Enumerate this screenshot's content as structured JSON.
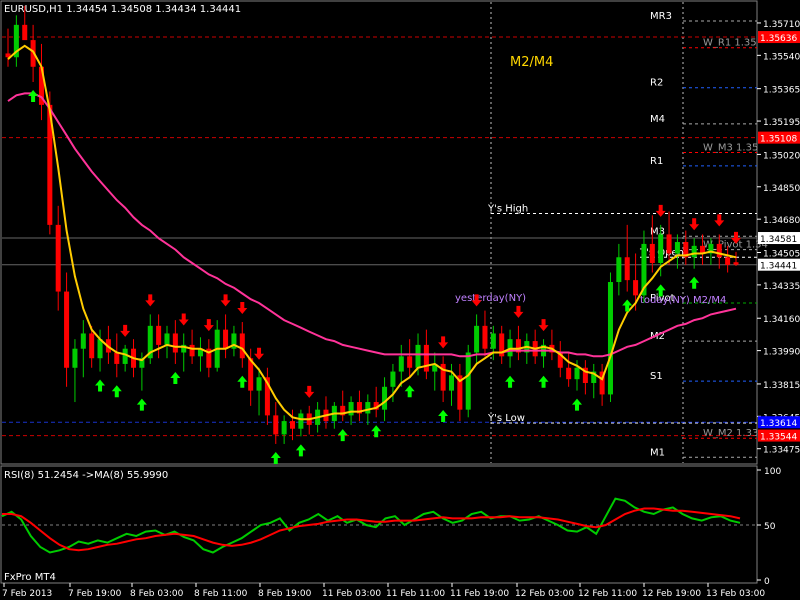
{
  "chart_data": [
    {
      "type": "candlestick",
      "title": "EURUSD,H1 1.34454 1.34508 1.34434 1.34441",
      "symbol": "EURUSD",
      "timeframe": "H1",
      "ohlc_header": "1.34454 1.34508 1.34434 1.34441",
      "indicator_label": "M2/M4",
      "ylim": [
        1.334,
        1.3582
      ],
      "price_ticks": [
        "1.35710",
        "1.35540",
        "1.35365",
        "1.35195",
        "1.35020",
        "1.34850",
        "1.34680",
        "1.34505",
        "1.34335",
        "1.34160",
        "1.33990",
        "1.33815",
        "1.33645",
        "1.33475"
      ],
      "price_tick_values": [
        1.3571,
        1.3554,
        1.35365,
        1.35195,
        1.3502,
        1.3485,
        1.3468,
        1.34505,
        1.34335,
        1.3416,
        1.3399,
        1.33815,
        1.33645,
        1.33475
      ],
      "price_badges": [
        {
          "text": "1.35636",
          "value": 1.35636,
          "color": "#ff0000"
        },
        {
          "text": "1.35108",
          "value": 1.35108,
          "color": "#ff0000"
        },
        {
          "text": "1.34581",
          "value": 1.34581,
          "color": "#ffffff"
        },
        {
          "text": "1.34441",
          "value": 1.34441,
          "color": "#ffffff"
        },
        {
          "text": "1.33614",
          "value": 1.33614,
          "color": "#0000ff"
        },
        {
          "text": "1.33544",
          "value": 1.33544,
          "color": "#ff0000"
        }
      ],
      "level_labels": [
        {
          "text": "MR3",
          "value": 1.3572
        },
        {
          "text": "W_R1 1.35",
          "value": 1.3558
        },
        {
          "text": "R2",
          "value": 1.3537
        },
        {
          "text": "M4",
          "value": 1.3518
        },
        {
          "text": "W_M3 1.35",
          "value": 1.3503
        },
        {
          "text": "R1",
          "value": 1.3496
        },
        {
          "text": "Y's High",
          "value": 1.3471
        },
        {
          "text": "M3",
          "value": 1.3459
        },
        {
          "text": "W_Pivot 1.34",
          "value": 1.3452
        },
        {
          "text": "T's Open",
          "value": 1.3448
        },
        {
          "text": "yesterday(NY)",
          "value": 1.3424
        },
        {
          "text": "Pivot",
          "value": 1.3424
        },
        {
          "text": "today(NY) M2/M4",
          "value": 1.3423
        },
        {
          "text": "M2",
          "value": 1.3404
        },
        {
          "text": "S1",
          "value": 1.3383
        },
        {
          "text": "Y's Low",
          "value": 1.3361
        },
        {
          "text": "W_M2 1.33",
          "value": 1.3353
        },
        {
          "text": "M1",
          "value": 1.3343
        }
      ],
      "colors": {
        "bull": "#00cc00",
        "bear": "#ff0000",
        "fast_ma": "#ffcc00",
        "slow_ma": "#ff3399",
        "text": "#ffffff",
        "indicator_label": "#ffd700"
      },
      "candles": [
        {
          "o": 1.3555,
          "h": 1.3568,
          "l": 1.3548,
          "c": 1.3553
        },
        {
          "o": 1.3553,
          "h": 1.3575,
          "l": 1.3548,
          "c": 1.357
        },
        {
          "o": 1.357,
          "h": 1.358,
          "l": 1.3565,
          "c": 1.3562
        },
        {
          "o": 1.3562,
          "h": 1.357,
          "l": 1.354,
          "c": 1.3548
        },
        {
          "o": 1.3548,
          "h": 1.356,
          "l": 1.352,
          "c": 1.3528
        },
        {
          "o": 1.3528,
          "h": 1.3535,
          "l": 1.346,
          "c": 1.3465
        },
        {
          "o": 1.3465,
          "h": 1.3475,
          "l": 1.342,
          "c": 1.343
        },
        {
          "o": 1.343,
          "h": 1.344,
          "l": 1.338,
          "c": 1.339
        },
        {
          "o": 1.339,
          "h": 1.3405,
          "l": 1.3372,
          "c": 1.34
        },
        {
          "o": 1.34,
          "h": 1.3415,
          "l": 1.3385,
          "c": 1.3408
        },
        {
          "o": 1.3408,
          "h": 1.3412,
          "l": 1.339,
          "c": 1.3395
        },
        {
          "o": 1.3395,
          "h": 1.341,
          "l": 1.3388,
          "c": 1.3405
        },
        {
          "o": 1.3405,
          "h": 1.3412,
          "l": 1.3392,
          "c": 1.3398
        },
        {
          "o": 1.3398,
          "h": 1.3408,
          "l": 1.3385,
          "c": 1.3392
        },
        {
          "o": 1.3392,
          "h": 1.3402,
          "l": 1.3388,
          "c": 1.34
        },
        {
          "o": 1.34,
          "h": 1.3405,
          "l": 1.3385,
          "c": 1.339
        },
        {
          "o": 1.339,
          "h": 1.3398,
          "l": 1.3378,
          "c": 1.3395
        },
        {
          "o": 1.3395,
          "h": 1.3418,
          "l": 1.3392,
          "c": 1.3412
        },
        {
          "o": 1.3412,
          "h": 1.3418,
          "l": 1.3395,
          "c": 1.3402
        },
        {
          "o": 1.3402,
          "h": 1.3412,
          "l": 1.3395,
          "c": 1.3408
        },
        {
          "o": 1.3408,
          "h": 1.3415,
          "l": 1.3392,
          "c": 1.3398
        },
        {
          "o": 1.3398,
          "h": 1.3408,
          "l": 1.3388,
          "c": 1.3402
        },
        {
          "o": 1.3402,
          "h": 1.341,
          "l": 1.3392,
          "c": 1.3396
        },
        {
          "o": 1.3396,
          "h": 1.3406,
          "l": 1.3388,
          "c": 1.34
        },
        {
          "o": 1.34,
          "h": 1.3405,
          "l": 1.3385,
          "c": 1.339
        },
        {
          "o": 1.339,
          "h": 1.3415,
          "l": 1.3388,
          "c": 1.341
        },
        {
          "o": 1.341,
          "h": 1.3418,
          "l": 1.3395,
          "c": 1.34
        },
        {
          "o": 1.34,
          "h": 1.3412,
          "l": 1.3396,
          "c": 1.3408
        },
        {
          "o": 1.3408,
          "h": 1.3414,
          "l": 1.339,
          "c": 1.3395
        },
        {
          "o": 1.3395,
          "h": 1.34,
          "l": 1.337,
          "c": 1.3378
        },
        {
          "o": 1.3378,
          "h": 1.339,
          "l": 1.3365,
          "c": 1.3385
        },
        {
          "o": 1.3385,
          "h": 1.339,
          "l": 1.336,
          "c": 1.3365
        },
        {
          "o": 1.3365,
          "h": 1.3372,
          "l": 1.335,
          "c": 1.3355
        },
        {
          "o": 1.3355,
          "h": 1.3365,
          "l": 1.335,
          "c": 1.3362
        },
        {
          "o": 1.3362,
          "h": 1.3368,
          "l": 1.3352,
          "c": 1.3358
        },
        {
          "o": 1.3358,
          "h": 1.3368,
          "l": 1.3354,
          "c": 1.3366
        },
        {
          "o": 1.3366,
          "h": 1.337,
          "l": 1.3355,
          "c": 1.336
        },
        {
          "o": 1.336,
          "h": 1.3372,
          "l": 1.3356,
          "c": 1.3368
        },
        {
          "o": 1.3368,
          "h": 1.3375,
          "l": 1.3358,
          "c": 1.3362
        },
        {
          "o": 1.3362,
          "h": 1.3372,
          "l": 1.3358,
          "c": 1.337
        },
        {
          "o": 1.337,
          "h": 1.3378,
          "l": 1.3362,
          "c": 1.3365
        },
        {
          "o": 1.3365,
          "h": 1.3375,
          "l": 1.336,
          "c": 1.3372
        },
        {
          "o": 1.3372,
          "h": 1.3378,
          "l": 1.3362,
          "c": 1.3366
        },
        {
          "o": 1.3366,
          "h": 1.3376,
          "l": 1.336,
          "c": 1.3372
        },
        {
          "o": 1.3372,
          "h": 1.338,
          "l": 1.3364,
          "c": 1.3368
        },
        {
          "o": 1.3368,
          "h": 1.3385,
          "l": 1.3362,
          "c": 1.338
        },
        {
          "o": 1.338,
          "h": 1.3392,
          "l": 1.3372,
          "c": 1.3388
        },
        {
          "o": 1.3388,
          "h": 1.3402,
          "l": 1.338,
          "c": 1.3396
        },
        {
          "o": 1.3396,
          "h": 1.3405,
          "l": 1.3385,
          "c": 1.339
        },
        {
          "o": 1.339,
          "h": 1.3408,
          "l": 1.3386,
          "c": 1.3402
        },
        {
          "o": 1.3402,
          "h": 1.341,
          "l": 1.3384,
          "c": 1.3388
        },
        {
          "o": 1.3388,
          "h": 1.3398,
          "l": 1.3378,
          "c": 1.3392
        },
        {
          "o": 1.3392,
          "h": 1.3396,
          "l": 1.3372,
          "c": 1.3378
        },
        {
          "o": 1.3378,
          "h": 1.3392,
          "l": 1.337,
          "c": 1.3386
        },
        {
          "o": 1.3386,
          "h": 1.3392,
          "l": 1.3362,
          "c": 1.3368
        },
        {
          "o": 1.3368,
          "h": 1.3402,
          "l": 1.3364,
          "c": 1.3398
        },
        {
          "o": 1.3398,
          "h": 1.3418,
          "l": 1.3392,
          "c": 1.3412
        },
        {
          "o": 1.3412,
          "h": 1.342,
          "l": 1.3396,
          "c": 1.34
        },
        {
          "o": 1.34,
          "h": 1.3412,
          "l": 1.3394,
          "c": 1.3408
        },
        {
          "o": 1.3408,
          "h": 1.3412,
          "l": 1.3392,
          "c": 1.3396
        },
        {
          "o": 1.3396,
          "h": 1.341,
          "l": 1.339,
          "c": 1.3405
        },
        {
          "o": 1.3405,
          "h": 1.3412,
          "l": 1.3394,
          "c": 1.3398
        },
        {
          "o": 1.3398,
          "h": 1.3408,
          "l": 1.3392,
          "c": 1.3404
        },
        {
          "o": 1.3404,
          "h": 1.341,
          "l": 1.3392,
          "c": 1.3396
        },
        {
          "o": 1.3396,
          "h": 1.3405,
          "l": 1.339,
          "c": 1.3402
        },
        {
          "o": 1.3402,
          "h": 1.341,
          "l": 1.3394,
          "c": 1.3398
        },
        {
          "o": 1.3398,
          "h": 1.3404,
          "l": 1.3385,
          "c": 1.339
        },
        {
          "o": 1.339,
          "h": 1.3398,
          "l": 1.338,
          "c": 1.3384
        },
        {
          "o": 1.3384,
          "h": 1.3394,
          "l": 1.3378,
          "c": 1.339
        },
        {
          "o": 1.339,
          "h": 1.3394,
          "l": 1.3376,
          "c": 1.3382
        },
        {
          "o": 1.3382,
          "h": 1.3392,
          "l": 1.3374,
          "c": 1.3388
        },
        {
          "o": 1.3388,
          "h": 1.3392,
          "l": 1.337,
          "c": 1.3376
        },
        {
          "o": 1.3376,
          "h": 1.344,
          "l": 1.3372,
          "c": 1.3435
        },
        {
          "o": 1.3435,
          "h": 1.3455,
          "l": 1.3428,
          "c": 1.3448
        },
        {
          "o": 1.3448,
          "h": 1.3465,
          "l": 1.343,
          "c": 1.3436
        },
        {
          "o": 1.3436,
          "h": 1.345,
          "l": 1.342,
          "c": 1.3428
        },
        {
          "o": 1.3428,
          "h": 1.3462,
          "l": 1.3424,
          "c": 1.3455
        },
        {
          "o": 1.3455,
          "h": 1.347,
          "l": 1.344,
          "c": 1.3445
        },
        {
          "o": 1.3445,
          "h": 1.3465,
          "l": 1.3438,
          "c": 1.346
        },
        {
          "o": 1.346,
          "h": 1.3472,
          "l": 1.3444,
          "c": 1.345
        },
        {
          "o": 1.345,
          "h": 1.346,
          "l": 1.3442,
          "c": 1.3456
        },
        {
          "o": 1.3456,
          "h": 1.3462,
          "l": 1.3444,
          "c": 1.3448
        },
        {
          "o": 1.3448,
          "h": 1.3458,
          "l": 1.3442,
          "c": 1.3454
        },
        {
          "o": 1.3454,
          "h": 1.346,
          "l": 1.3444,
          "c": 1.345
        },
        {
          "o": 1.345,
          "h": 1.3458,
          "l": 1.3444,
          "c": 1.3455
        },
        {
          "o": 1.3455,
          "h": 1.346,
          "l": 1.3442,
          "c": 1.3448
        },
        {
          "o": 1.3448,
          "h": 1.3454,
          "l": 1.344,
          "c": 1.3444
        },
        {
          "o": 1.34454,
          "h": 1.34508,
          "l": 1.34434,
          "c": 1.34441
        }
      ],
      "fast_ma": [
        1.3552,
        1.3556,
        1.3559,
        1.3556,
        1.3548,
        1.3525,
        1.3495,
        1.3462,
        1.3438,
        1.3421,
        1.341,
        1.3405,
        1.3401,
        1.3398,
        1.3397,
        1.3395,
        1.3394,
        1.3398,
        1.34,
        1.3402,
        1.3401,
        1.3401,
        1.34,
        1.34,
        1.3398,
        1.34,
        1.34,
        1.3402,
        1.34,
        1.3394,
        1.3389,
        1.3382,
        1.3374,
        1.3368,
        1.3364,
        1.3363,
        1.3363,
        1.3364,
        1.3365,
        1.3366,
        1.3366,
        1.3367,
        1.3367,
        1.3368,
        1.3369,
        1.3372,
        1.3376,
        1.3382,
        1.3385,
        1.339,
        1.3391,
        1.3392,
        1.3389,
        1.3388,
        1.3383,
        1.3386,
        1.3392,
        1.3395,
        1.3398,
        1.3398,
        1.34,
        1.34,
        1.3401,
        1.34,
        1.3401,
        1.34,
        1.3397,
        1.3393,
        1.3391,
        1.3388,
        1.3387,
        1.3384,
        1.3396,
        1.341,
        1.3419,
        1.3424,
        1.3432,
        1.3437,
        1.3443,
        1.3446,
        1.3449,
        1.3449,
        1.345,
        1.345,
        1.3451,
        1.345,
        1.3449,
        1.3448
      ],
      "slow_ma": [
        1.353,
        1.3533,
        1.3534,
        1.3534,
        1.3532,
        1.3526,
        1.3519,
        1.3512,
        1.3505,
        1.3499,
        1.3493,
        1.3488,
        1.3483,
        1.3478,
        1.3474,
        1.3469,
        1.3465,
        1.3462,
        1.3458,
        1.3455,
        1.3452,
        1.3448,
        1.3445,
        1.3442,
        1.3439,
        1.3437,
        1.3434,
        1.3432,
        1.3429,
        1.3426,
        1.3424,
        1.3421,
        1.3418,
        1.3415,
        1.3413,
        1.3411,
        1.3409,
        1.3407,
        1.3405,
        1.3404,
        1.3402,
        1.3401,
        1.34,
        1.3399,
        1.3398,
        1.3397,
        1.3397,
        1.3397,
        1.3397,
        1.3397,
        1.3397,
        1.3397,
        1.3397,
        1.3397,
        1.3396,
        1.3396,
        1.3397,
        1.3397,
        1.3398,
        1.3398,
        1.3399,
        1.3399,
        1.3399,
        1.3399,
        1.3399,
        1.3399,
        1.3398,
        1.3398,
        1.3397,
        1.3397,
        1.3396,
        1.3396,
        1.3397,
        1.3399,
        1.3401,
        1.3402,
        1.3404,
        1.3406,
        1.3408,
        1.341,
        1.3412,
        1.3413,
        1.3415,
        1.3416,
        1.3418,
        1.3419,
        1.342,
        1.3421
      ]
    },
    {
      "type": "line",
      "title": "RSI(8) 51.2454 ->MA(8) 55.9990",
      "ylim": [
        0,
        100
      ],
      "yticks": [
        "100",
        "50",
        "0"
      ],
      "ytick_values": [
        100,
        50,
        0
      ],
      "series": [
        {
          "name": "RSI(8)",
          "color": "#00cc00",
          "values": [
            58,
            62,
            55,
            40,
            30,
            25,
            27,
            30,
            35,
            33,
            36,
            34,
            38,
            42,
            40,
            44,
            45,
            41,
            44,
            39,
            36,
            28,
            25,
            30,
            34,
            38,
            44,
            50,
            52,
            56,
            45,
            52,
            55,
            60,
            54,
            58,
            52,
            55,
            50,
            48,
            56,
            58,
            50,
            55,
            60,
            62,
            56,
            52,
            54,
            60,
            62,
            56,
            58,
            58,
            54,
            55,
            58,
            54,
            50,
            45,
            44,
            48,
            42,
            58,
            74,
            72,
            66,
            62,
            60,
            64,
            66,
            60,
            56,
            54,
            57,
            58,
            54,
            52
          ]
        },
        {
          "name": "MA(8)",
          "color": "#ff0000",
          "values": [
            60,
            60,
            58,
            52,
            45,
            38,
            32,
            28,
            27,
            28,
            30,
            32,
            33,
            35,
            37,
            38,
            40,
            41,
            42,
            41,
            40,
            37,
            34,
            32,
            31,
            32,
            34,
            37,
            41,
            45,
            47,
            49,
            50,
            51,
            53,
            54,
            55,
            55,
            54,
            53,
            53,
            54,
            54,
            54,
            55,
            56,
            57,
            56,
            56,
            56,
            57,
            57,
            57,
            58,
            57,
            57,
            57,
            56,
            55,
            53,
            51,
            49,
            48,
            50,
            55,
            60,
            63,
            65,
            65,
            64,
            63,
            63,
            62,
            61,
            60,
            59,
            58,
            56
          ]
        }
      ],
      "level_lines": [
        50
      ]
    }
  ],
  "time_labels": [
    "7 Feb 2013",
    "7 Feb 19:00",
    "8 Feb 03:00",
    "8 Feb 11:00",
    "8 Feb 19:00",
    "11 Feb 03:00",
    "11 Feb 11:00",
    "11 Feb 19:00",
    "12 Feb 03:00",
    "12 Feb 11:00",
    "12 Feb 19:00",
    "13 Feb 03:00"
  ],
  "broker": "FxPro MT4",
  "buy_arrows": [
    3,
    11,
    13,
    16,
    20,
    28,
    32,
    35,
    40,
    44,
    48,
    52,
    60,
    64,
    68,
    74,
    78,
    82
  ],
  "sell_arrows": [
    14,
    17,
    21,
    24,
    26,
    28,
    30,
    36,
    52,
    56,
    61,
    64,
    78,
    82,
    85,
    87
  ]
}
